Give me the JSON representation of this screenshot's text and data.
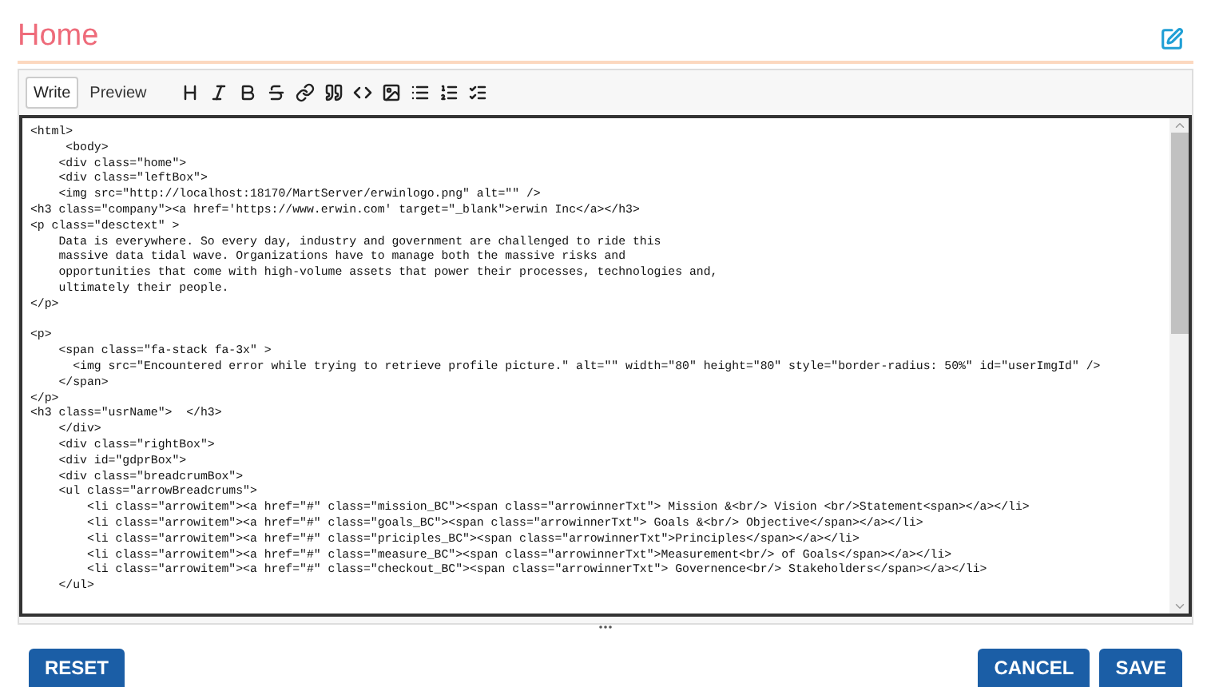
{
  "page": {
    "title": "Home"
  },
  "editor": {
    "tabs": [
      {
        "label": "Write",
        "selected": true
      },
      {
        "label": "Preview",
        "selected": false
      }
    ],
    "code_blocks": [
      [
        "<html>",
        "     <body>",
        "    <div class=\"home\">",
        "    <div class=\"leftBox\">",
        "    <img src=\"http://localhost:18170/MartServer/erwinlogo.png\" alt=\"\" />",
        "<h3 class=\"company\"><a href='https://www.erwin.com' target=\"_blank\">erwin Inc</a></h3>",
        "<p class=\"desctext\" >",
        "    Data is everywhere. So every day, industry and government are challenged to ride this",
        "    massive data tidal wave. Organizations have to manage both the massive risks and",
        "    opportunities that come with high-volume assets that power their processes, technologies and,",
        "    ultimately their people.",
        "</p>"
      ],
      [
        "<p>",
        "    <span class=\"fa-stack fa-3x\" >",
        "      <img src=\"Encountered error while trying to retrieve profile picture.\" alt=\"\" width=\"80\" height=\"80\" style=\"border-radius: 50%\" id=\"userImgId\" />",
        "    </span>",
        "</p>",
        "<h3 class=\"usrName\">  </h3>",
        "    </div>",
        "    <div class=\"rightBox\">",
        "    <div id=\"gdprBox\">",
        "    <div class=\"breadcrumBox\">",
        "    <ul class=\"arrowBreadcrums\">",
        "        <li class=\"arrowitem\"><a href=\"#\" class=\"mission_BC\"><span class=\"arrowinnerTxt\"> Mission &<br/> Vision <br/>Statement<span></a></li>",
        "        <li class=\"arrowitem\"><a href=\"#\" class=\"goals_BC\"><span class=\"arrowinnerTxt\"> Goals &<br/> Objective</span></a></li>",
        "        <li class=\"arrowitem\"><a href=\"#\" class=\"priciples_BC\"><span class=\"arrowinnerTxt\">Principles</span></a></li>",
        "        <li class=\"arrowitem\"><a href=\"#\" class=\"measure_BC\"><span class=\"arrowinnerTxt\">Measurement<br/> of Goals</span></a></li>",
        "        <li class=\"arrowitem\"><a href=\"#\" class=\"checkout_BC\"><span class=\"arrowinnerTxt\"> Governence<br/> Stakeholders</span></a></li>",
        "    </ul>"
      ]
    ]
  },
  "actions": {
    "left": [
      {
        "label": "RESET"
      }
    ],
    "right": [
      {
        "label": "CANCEL"
      },
      {
        "label": "SAVE"
      }
    ]
  }
}
